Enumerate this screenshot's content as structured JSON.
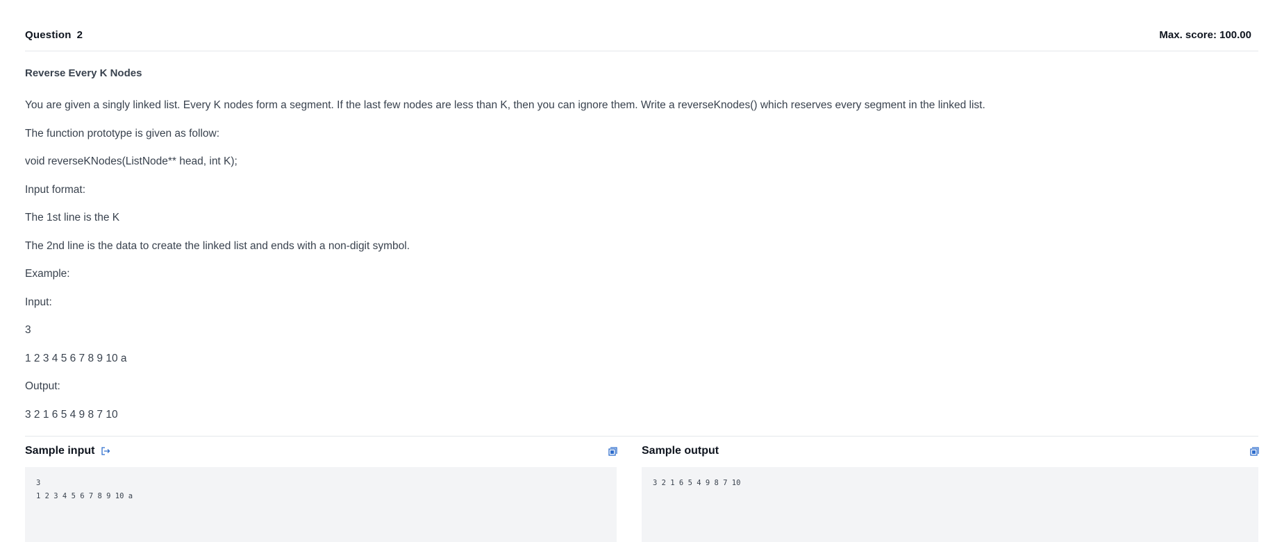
{
  "question": {
    "label": "Question",
    "number": "2",
    "max_score": "Max. score: 100.00"
  },
  "problem": {
    "title": "Reverse Every K Nodes",
    "paragraphs": [
      "You are given a singly linked list. Every K nodes form a segment. If the last few nodes are less than K, then you can ignore them. Write a reverseKnodes() which reserves every segment in the linked list.",
      "The function prototype is given as follow:",
      "void reverseKNodes(ListNode** head, int K);",
      "Input format:",
      "The 1st line is the K",
      "The 2nd line is the data to create the linked list and ends with a non-digit symbol.",
      "Example:",
      "Input:",
      "3",
      "1 2 3 4 5 6 7 8 9 10 a",
      "Output:",
      "3 2 1 6 5 4 9 8 7 10"
    ]
  },
  "samples": {
    "input_label": "Sample input",
    "output_label": "Sample output",
    "input_text": "3\n1 2 3 4 5 6 7 8 9 10 a",
    "output_text": "3 2 1 6 5 4 9 8 7 10",
    "icon_color": "#1ba94c",
    "accent_color": "#2f6ecd"
  },
  "icons": {
    "export": "export-icon",
    "copy": "copy-icon"
  }
}
